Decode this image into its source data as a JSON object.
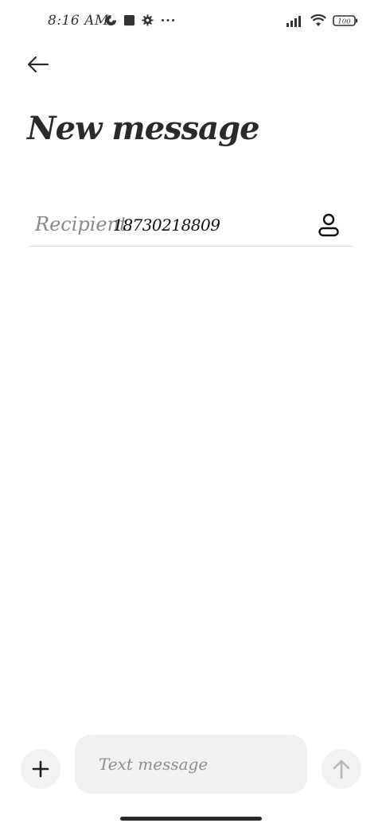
{
  "status_bar": {
    "time": "8:16 AM",
    "battery_level": "100",
    "icons_left": [
      "data-saver-icon",
      "square-notification-icon",
      "gear-icon",
      "more-dots-icon"
    ],
    "icons_right": [
      "signal-icon",
      "wifi-icon",
      "battery-icon"
    ]
  },
  "header": {
    "back_icon": "arrow-left-icon",
    "title": "New message"
  },
  "recipient": {
    "label": "Recipient:",
    "value": "18730218809",
    "contact_icon": "person-icon"
  },
  "compose": {
    "add_icon": "plus-icon",
    "placeholder": "Text message",
    "value": "",
    "send_icon": "arrow-up-icon"
  },
  "colors": {
    "background": "#ffffff",
    "text": "#222222",
    "muted": "#888888",
    "button_bg": "#f2f2f2",
    "field_bg": "#f1f1f1",
    "divider": "#dcdcdc",
    "send_disabled": "#b8b8b8"
  }
}
